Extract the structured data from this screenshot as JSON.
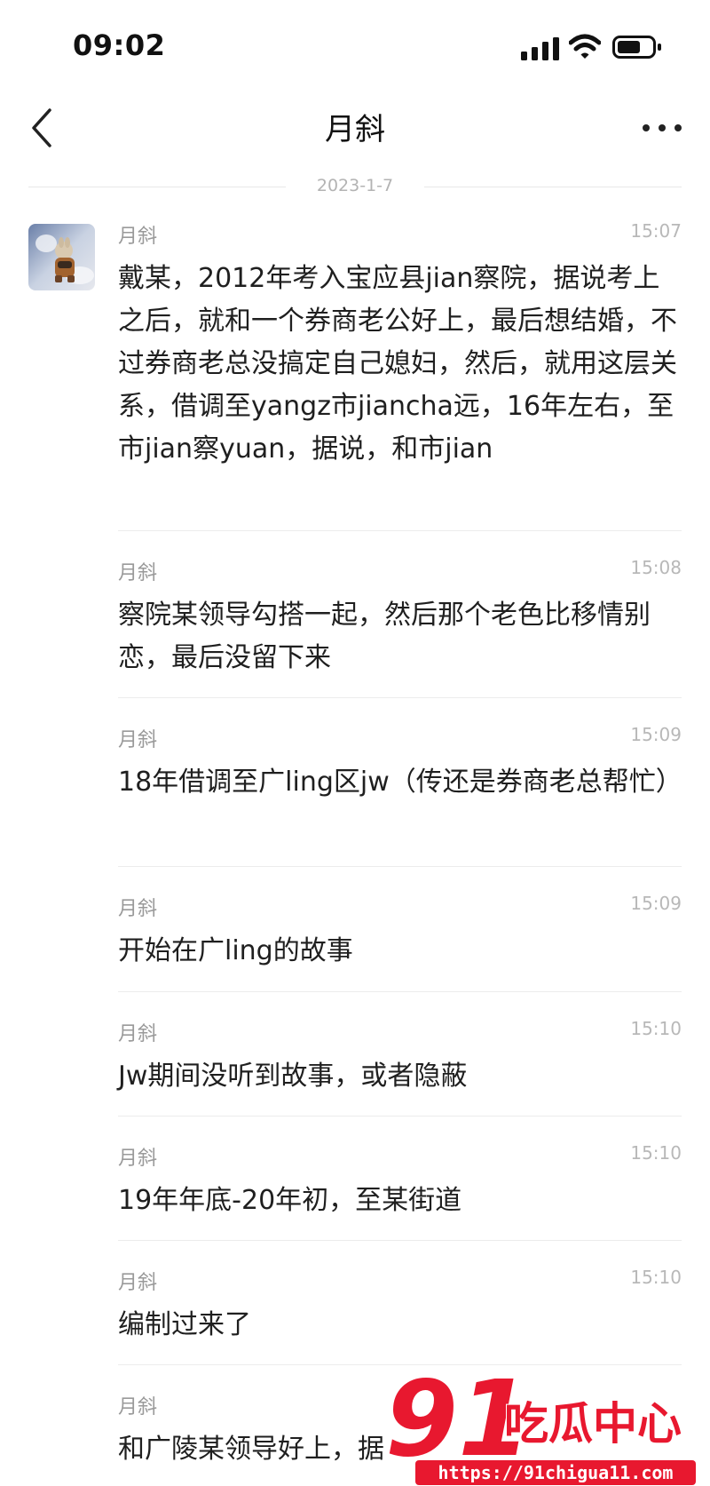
{
  "status_bar": {
    "time": "09:02"
  },
  "header": {
    "title": "月斜"
  },
  "date_divider": "2023-1-7",
  "messages": [
    {
      "sender": "月斜",
      "time": "15:07",
      "text": "戴某，2012年考入宝应县jian察院，据说考上之后，就和一个券商老公好上，最后想结婚，不过券商老总没搞定自己媳妇，然后，就用这层关系，借调至yangz市jiancha远，16年左右，至市jian察yuan，据说，和市jian"
    },
    {
      "sender": "月斜",
      "time": "15:08",
      "text": "察院某领导勾搭一起，然后那个老色比移情别恋，最后没留下来"
    },
    {
      "sender": "月斜",
      "time": "15:09",
      "text": "18年借调至广ling区jw（传还是券商老总帮忙）"
    },
    {
      "sender": "月斜",
      "time": "15:09",
      "text": "开始在广ling的故事"
    },
    {
      "sender": "月斜",
      "time": "15:10",
      "text": "Jw期间没听到故事，或者隐蔽"
    },
    {
      "sender": "月斜",
      "time": "15:10",
      "text": "19年年底-20年初，至某街道"
    },
    {
      "sender": "月斜",
      "time": "15:10",
      "text": "编制过来了"
    },
    {
      "sender": "月斜",
      "time": "",
      "text": "和广陵某领导好上，据"
    }
  ],
  "watermark": {
    "brand_number": "91",
    "brand_text": "吃瓜中心",
    "url": "https://91chigua11.com"
  },
  "icons": {
    "back": "chevron-left-icon",
    "more": "more-dots-icon",
    "signal": "cellular-signal-icon",
    "wifi": "wifi-icon",
    "battery": "battery-icon"
  },
  "colors": {
    "watermark": "#e8182f",
    "meta_text": "#9a9a9a",
    "divider": "#ececec"
  }
}
